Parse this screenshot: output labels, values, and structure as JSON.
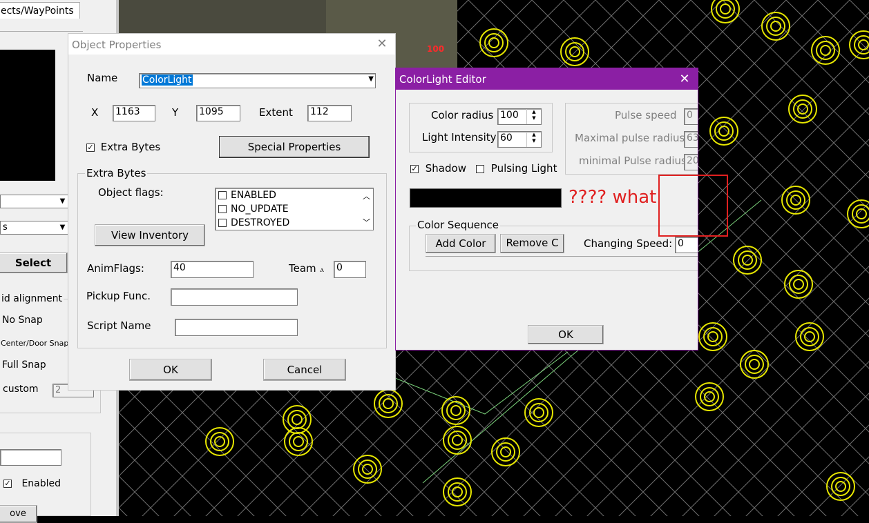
{
  "left_panel": {
    "tab_label": "ects/WayPoints",
    "combo2_value": "s",
    "select_button": "Select",
    "grid_group_title": "id alignment",
    "no_snap": "No Snap",
    "center_door_snap": "Center/Door Snap",
    "full_snap": "Full Snap",
    "custom": "custom",
    "custom_value": "2",
    "enabled_label": "Enabled",
    "bottom_button": "ove"
  },
  "map": {
    "label_100": "100"
  },
  "object_properties": {
    "title": "Object Properties",
    "name_label": "Name",
    "name_value": "ColorLight",
    "x_label": "X",
    "x_value": "1163",
    "y_label": "Y",
    "y_value": "1095",
    "extent_label": "Extent",
    "extent_value": "112",
    "extra_bytes_check": "Extra Bytes",
    "special_properties": "Special Properties",
    "extra_bytes_group": "Extra Bytes",
    "object_flags_label": "Object flags:",
    "flags": [
      "ENABLED",
      "NO_UPDATE",
      "DESTROYED"
    ],
    "view_inventory": "View Inventory",
    "anim_flags_label": "AnimFlags:",
    "anim_flags_value": "40",
    "team_label": "Team",
    "team_value": "0",
    "pickup_label": "Pickup Func.",
    "script_label": "Script Name",
    "ok": "OK",
    "cancel": "Cancel"
  },
  "colorlight_editor": {
    "title": "ColorLight Editor",
    "color_radius_label": "Color radius",
    "color_radius_value": "100",
    "light_intensity_label": "Light Intensity",
    "light_intensity_value": "60",
    "pulse_speed_label": "Pulse speed",
    "pulse_speed_value": "0",
    "max_pulse_label": "Maximal pulse radius",
    "max_pulse_value": "63",
    "min_pulse_label": "minimal Pulse radius",
    "min_pulse_value": "20",
    "shadow_label": "Shadow",
    "pulsing_label": "Pulsing Light",
    "annotation": "???? what",
    "color_sequence_title": "Color Sequence",
    "add_color": "Add Color",
    "remove_color": "Remove C",
    "changing_speed_label": "Changing Speed:",
    "changing_speed_value": "0",
    "ok": "OK"
  },
  "colors": {
    "editor_titlebar": "#8b1fa4",
    "annotation_red": "#e02020",
    "selection_blue": "#0078d7"
  }
}
